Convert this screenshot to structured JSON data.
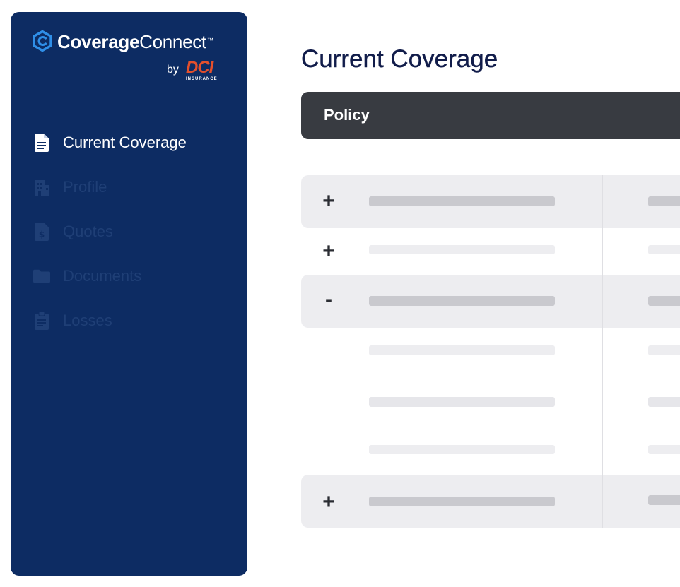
{
  "brand": {
    "name_bold": "Coverage",
    "name_light": "Connect",
    "trademark": "™",
    "by": "by",
    "partner_letters": "DCI",
    "partner_sub": "INSURANCE",
    "accent_color": "#2f8fe8",
    "partner_color": "#e4502c"
  },
  "sidebar": {
    "background": "#0d2c63",
    "items": [
      {
        "label": "Current Coverage",
        "icon": "document-icon",
        "active": true
      },
      {
        "label": "Profile",
        "icon": "building-icon",
        "active": false
      },
      {
        "label": "Quotes",
        "icon": "dollar-file-icon",
        "active": false
      },
      {
        "label": "Documents",
        "icon": "folder-icon",
        "active": false
      },
      {
        "label": "Losses",
        "icon": "clipboard-icon",
        "active": false
      }
    ]
  },
  "main": {
    "title": "Current Coverage",
    "table": {
      "header_label": "Policy",
      "rows": [
        {
          "toggle": "+",
          "shaded": true
        },
        {
          "toggle": "+",
          "shaded": false
        },
        {
          "toggle": "-",
          "shaded": true
        },
        {
          "toggle": "",
          "shaded": false
        },
        {
          "toggle": "",
          "shaded": false
        },
        {
          "toggle": "",
          "shaded": false
        },
        {
          "toggle": "+",
          "shaded": true
        }
      ]
    }
  }
}
